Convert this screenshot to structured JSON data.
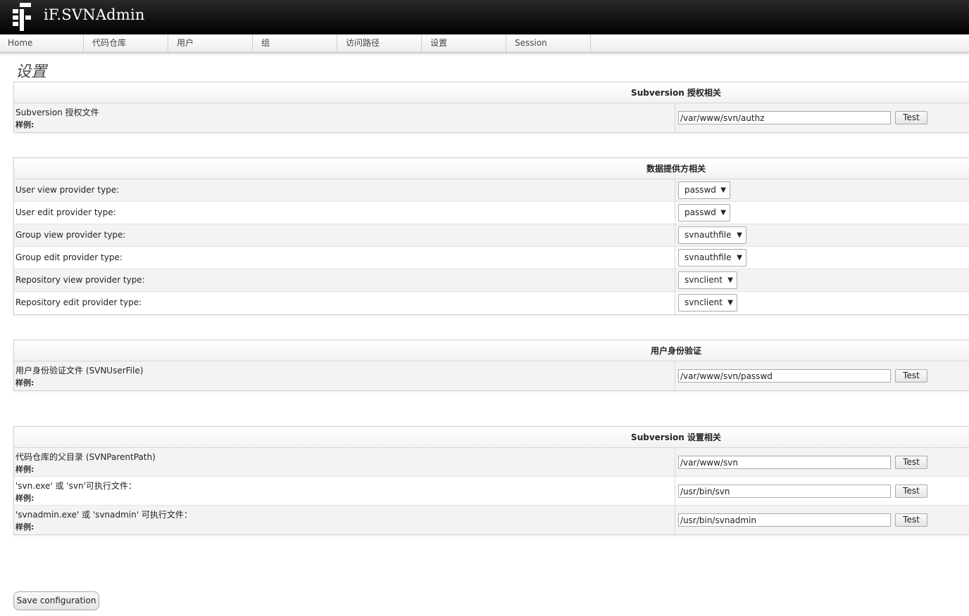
{
  "app": {
    "title": "iF.SVNAdmin"
  },
  "nav": [
    {
      "label": "Home"
    },
    {
      "label": "代码仓库"
    },
    {
      "label": "用户"
    },
    {
      "label": "组"
    },
    {
      "label": "访问路径"
    },
    {
      "label": "设置"
    },
    {
      "label": "Session"
    }
  ],
  "page": {
    "title": "设置",
    "save_label": "Save configuration"
  },
  "common": {
    "sample_label": "样例:",
    "test_label": "Test"
  },
  "sections": {
    "authz": {
      "title": "Subversion 授权相关",
      "rows": [
        {
          "label": "Subversion 授权文件",
          "value": "/var/www/svn/authz"
        }
      ]
    },
    "providers": {
      "title": "数据提供方相关",
      "rows": [
        {
          "label": "User view provider type:",
          "selected": "passwd"
        },
        {
          "label": "User edit provider type:",
          "selected": "passwd"
        },
        {
          "label": "Group view provider type:",
          "selected": "svnauthfile"
        },
        {
          "label": "Group edit provider type:",
          "selected": "svnauthfile"
        },
        {
          "label": "Repository view provider type:",
          "selected": "svnclient"
        },
        {
          "label": "Repository edit provider type:",
          "selected": "svnclient"
        }
      ]
    },
    "userauth": {
      "title": "用户身份验证",
      "rows": [
        {
          "label": "用户身份验证文件 (SVNUserFile)",
          "value": "/var/www/svn/passwd"
        }
      ]
    },
    "svnsettings": {
      "title": "Subversion 设置相关",
      "rows": [
        {
          "label": "代码仓库的父目录 (SVNParentPath)",
          "value": "/var/www/svn"
        },
        {
          "label": "'svn.exe' 或 'svn'可执行文件：",
          "value": "/usr/bin/svn"
        },
        {
          "label": "'svnadmin.exe' 或 'svnadmin' 可执行文件：",
          "value": "/usr/bin/svnadmin"
        }
      ]
    }
  }
}
